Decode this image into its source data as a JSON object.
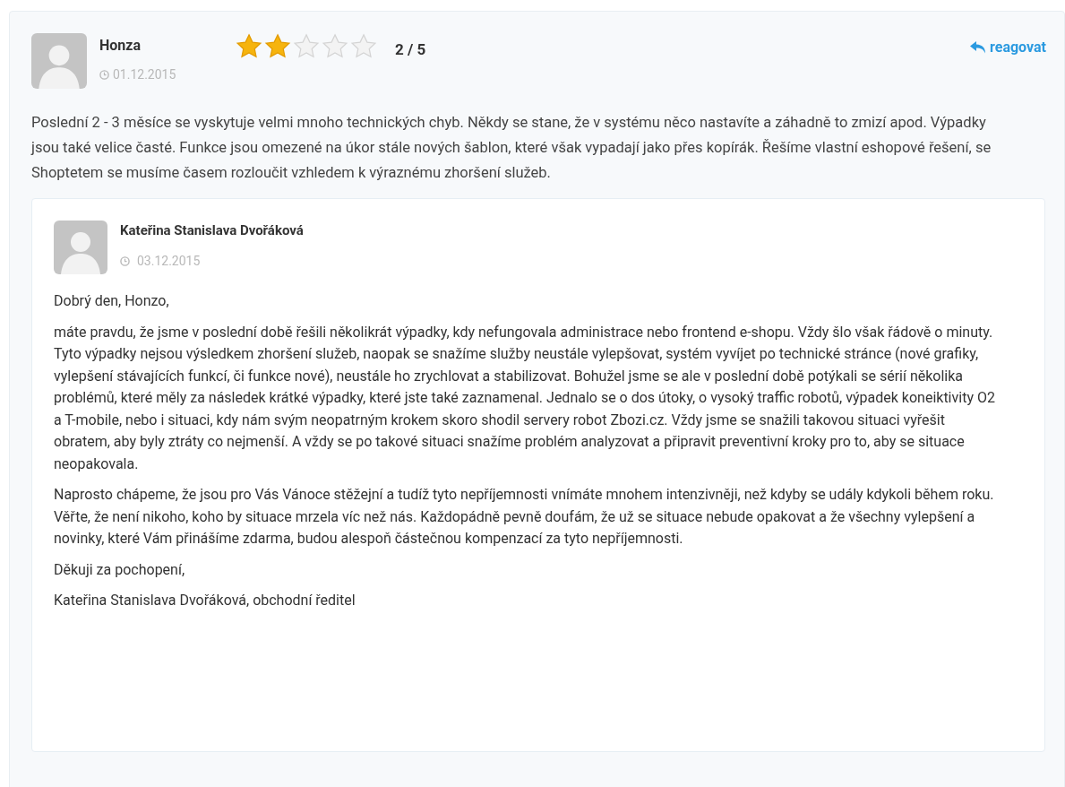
{
  "review": {
    "author": "Honza",
    "date": "01.12.2015",
    "stars": 2,
    "rating": "2 / 5",
    "reply_link": "reagovat",
    "text": "Poslední 2 - 3 měsíce se vyskytuje velmi mnoho technických chyb. Někdy se stane, že v systému něco nastavíte a záhadně to zmizí apod. Výpadky jsou také velice časté. Funkce jsou omezené na úkor stále nových šablon, které však vypadají jako přes kopírák. Řešíme vlastní eshopové řešení, se Shoptetem se musíme časem rozloučit vzhledem k výraznému zhoršení služeb."
  },
  "response": {
    "author": "Kateřina Stanislava Dvořáková",
    "date": "03.12.2015",
    "paragraphs": [
      "Dobrý den, Honzo,",
      "máte pravdu, že jsme v poslední době řešili několikrát výpadky, kdy nefungovala administrace nebo frontend e-shopu. Vždy šlo však řádově o minuty. Tyto výpadky nejsou výsledkem zhoršení služeb, naopak se snažíme služby neustále vylepšovat, systém vyvíjet po technické stránce (nové grafiky, vylepšení stávajících funkcí, či funkce nové), neustále ho zrychlovat a stabilizovat. Bohužel jsme se ale v poslední době potýkali se sérií několika problémů, které měly za následek krátké výpadky, které jste také zaznamenal. Jednalo se o dos útoky, o vysoký traffic robotů, výpadek koneiktivity O2 a T-mobile, nebo i situaci, kdy nám svým neopatrným krokem skoro shodil servery robot Zbozi.cz. Vždy jsme se snažili takovou situaci vyřešit obratem, aby byly ztráty co nejmenší. A vždy se po takové situaci snažíme problém analyzovat a připravit preventivní kroky pro to, aby se situace neopakovala.",
      "Naprosto chápeme, že jsou pro Vás Vánoce stěžejní a tudíž tyto nepříjemnosti vnímáte mnohem intenzivněji, než kdyby se udály kdykoli během roku. Věřte, že není nikoho, koho by situace mrzela víc než nás. Každopádně pevně doufám, že už se situace nebude opakovat a že všechny vylepšení a novinky, které Vám přinášíme zdarma, budou alespoň částečnou kompenzací za tyto nepříjemnosti.",
      "Děkuji za pochopení,",
      "Kateřina Stanislava Dvořáková, obchodní ředitel"
    ]
  }
}
